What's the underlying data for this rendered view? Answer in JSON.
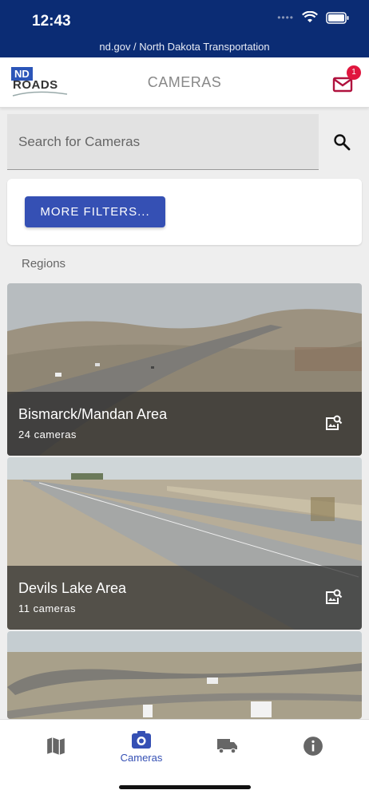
{
  "status_bar": {
    "time": "12:43",
    "url": "nd.gov / North Dakota Transportation"
  },
  "header": {
    "logo_nd": "ND",
    "logo_roads": "ROADS",
    "title": "CAMERAS",
    "mail_badge": "1"
  },
  "search": {
    "placeholder": "Search for Cameras"
  },
  "filters": {
    "button_label": "MORE FILTERS..."
  },
  "regions": {
    "label": "Regions",
    "items": [
      {
        "name": "Bismarck/Mandan Area",
        "count": "24 cameras"
      },
      {
        "name": "Devils Lake Area",
        "count": "11 cameras"
      }
    ]
  },
  "bottom_nav": {
    "items": [
      {
        "icon": "map-icon",
        "label": ""
      },
      {
        "icon": "camera-icon",
        "label": "Cameras"
      },
      {
        "icon": "truck-icon",
        "label": ""
      },
      {
        "icon": "info-icon",
        "label": ""
      }
    ]
  },
  "colors": {
    "status_bar": "#0b2c74",
    "accent": "#3550b4",
    "badge": "#e0163e",
    "mail": "#b0123e"
  }
}
